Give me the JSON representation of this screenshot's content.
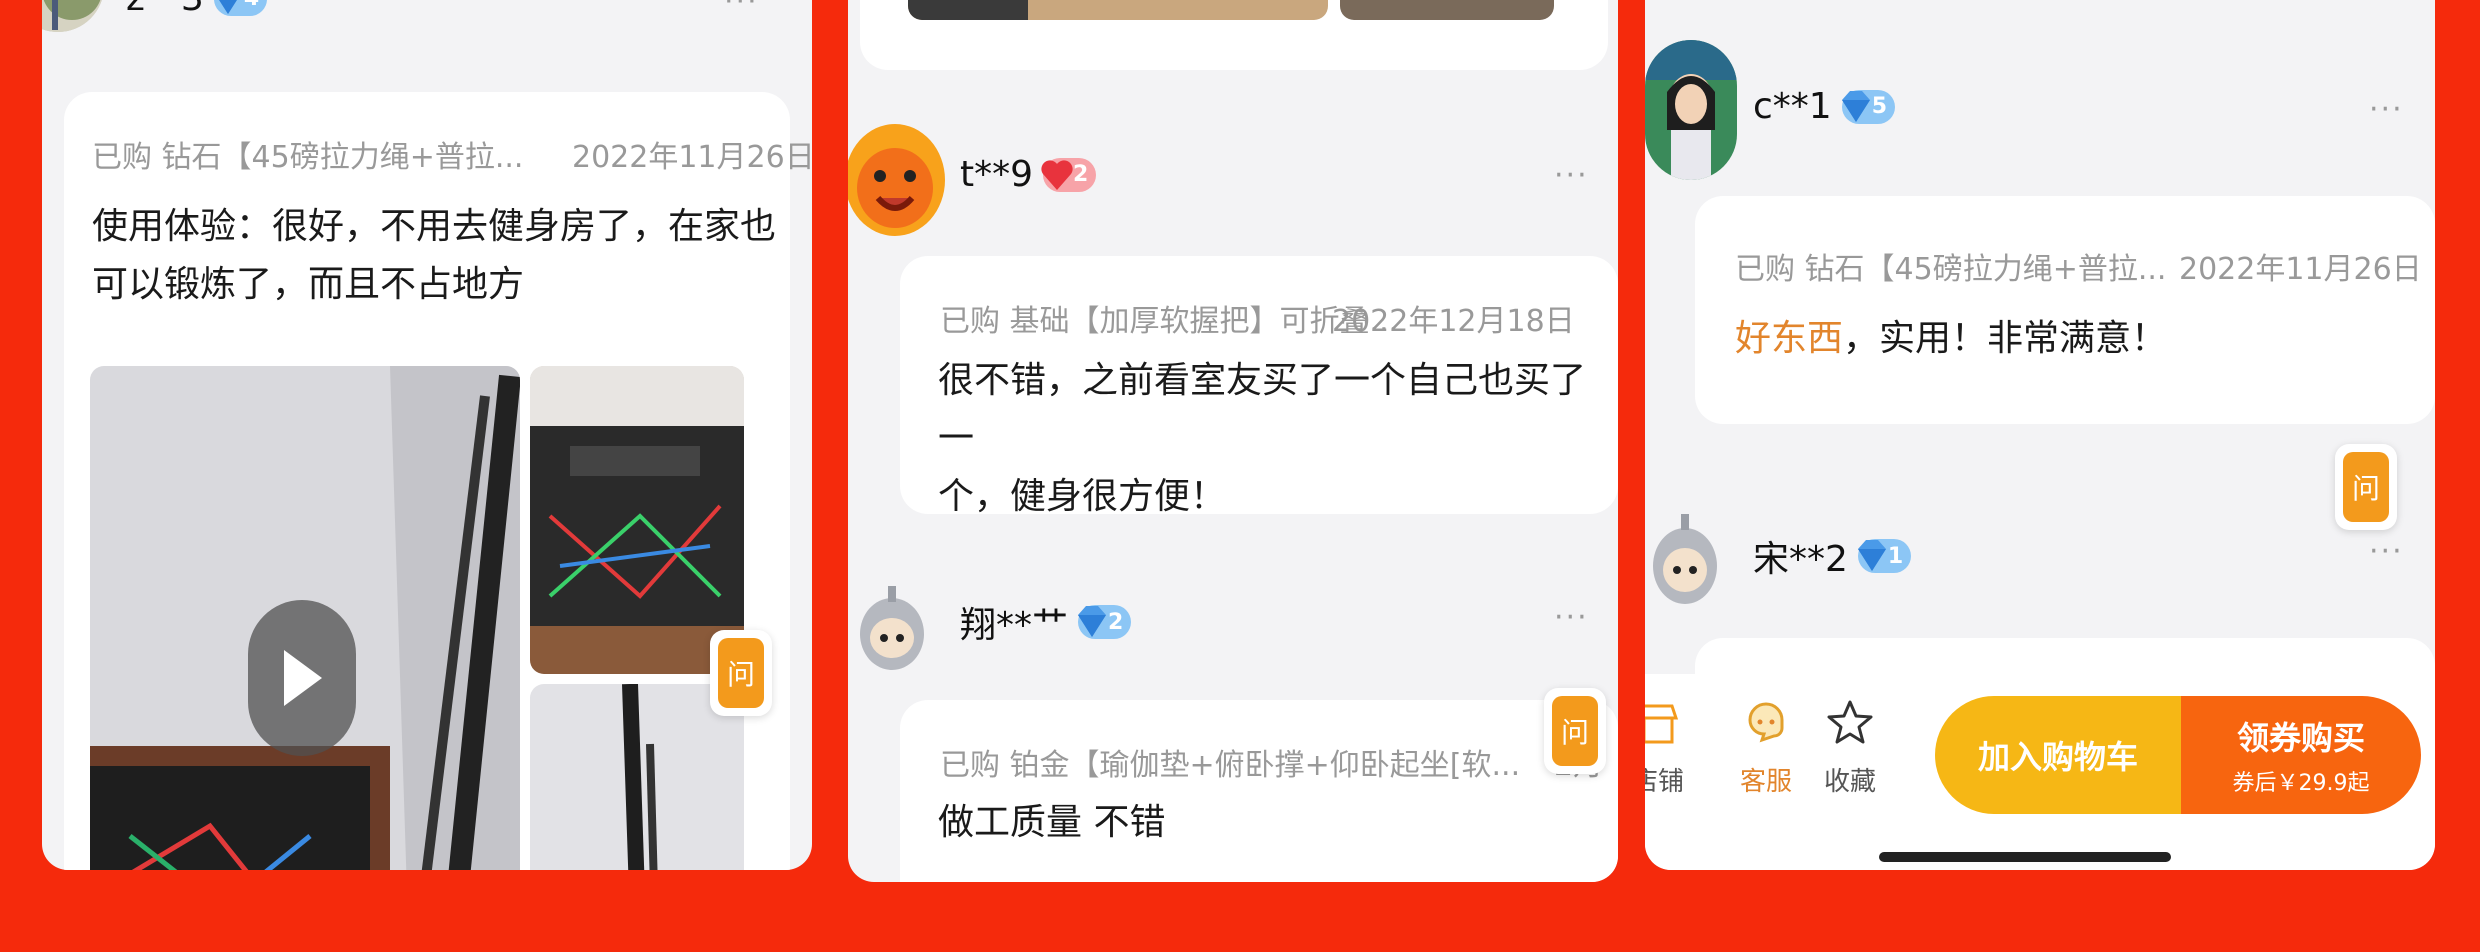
{
  "colors": {
    "background": "#f52a0c",
    "accent_orange": "#f39a1c",
    "highlight_text": "#e2852c",
    "cart_button": "#f6b715",
    "buy_button": "#f7650f"
  },
  "panel1": {
    "user": {
      "name": "z**3",
      "level": "4",
      "badge": "diamond"
    },
    "more": "···",
    "review": {
      "purchased": "已购 钻石【45磅拉力绳+普拉...",
      "date": "2022年11月26日",
      "text_line1": "使用体验：很好，不用去健身房了，在家也",
      "text_line2": "可以锻炼了，而且不占地方"
    },
    "ask_label": "问"
  },
  "panel2": {
    "review1": {
      "user": {
        "name": "t**9",
        "level": "2",
        "badge": "heart"
      },
      "more": "···",
      "purchased": "已购 基础【加厚软握把】可折叠...",
      "date": "2022年12月18日",
      "text_line1": "很不错，之前看室友买了一个自己也买了一",
      "text_line2": "个，健身很方便！"
    },
    "review2": {
      "user": {
        "name": "翔**艹",
        "level": "2",
        "badge": "diamond"
      },
      "more": "···",
      "purchased": "已购 铂金【瑜伽垫+俯卧撑+仰卧起坐[软...",
      "date": "2月",
      "text": "做工质量 不错"
    },
    "ask_label": "问"
  },
  "panel3": {
    "review1": {
      "user": {
        "name": "c**1",
        "level": "5",
        "badge": "diamond"
      },
      "more": "···",
      "purchased": "已购 钻石【45磅拉力绳+普拉...",
      "date": "2022年11月26日",
      "text_highlight": "好东西",
      "text_rest": "，实用！非常满意！"
    },
    "review2": {
      "user": {
        "name": "宋**2",
        "level": "1",
        "badge": "diamond"
      },
      "more": "···"
    },
    "ask_label": "问",
    "tabbar": {
      "store": "店铺",
      "service": "客服",
      "favorite": "收藏",
      "add_to_cart": "加入购物车",
      "buy_label": "领券购买",
      "buy_price": "券后￥29.9起"
    }
  }
}
